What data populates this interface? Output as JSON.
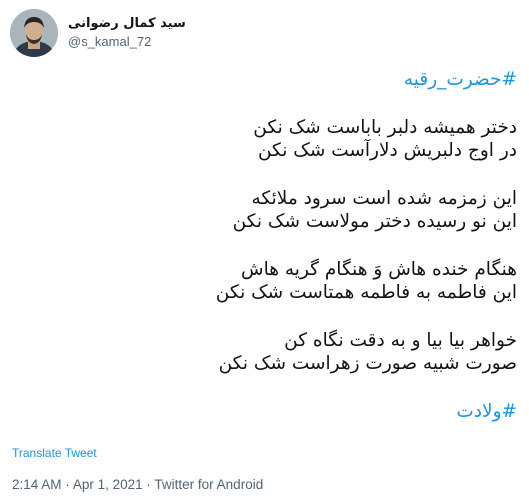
{
  "user": {
    "display_name": "سید کمال رضوانی",
    "handle": "@s_kamal_72"
  },
  "tweet": {
    "hashtag_top": "#حضرت_رقیه",
    "stanzas": [
      [
        "دختر همیشه دلبر باباست شک نکن",
        "در اوج دلبریش دلارآست شک نکن"
      ],
      [
        "این زمزمه شده است سرود ملائکه",
        "این نو رسیده دختر مولاست شک نکن"
      ],
      [
        "هنگام خنده هاش وَ هنگام گریه هاش",
        "این فاطمه به فاطمه همتاست شک نکن"
      ],
      [
        "خواهر بیا بیا و به دقت نگاه کن",
        "صورت شبیه صورت زهراست شک نکن"
      ]
    ],
    "hashtag_bottom": "#ولادت",
    "translate_label": "Translate Tweet",
    "time": "2:14 AM",
    "date": "Apr 1, 2021",
    "source": "Twitter for Android",
    "separator": "·"
  },
  "colors": {
    "link": "#1b95e0",
    "text": "#0f1419",
    "muted": "#536471"
  },
  "icons": {
    "avatar": "profile-photo-avatar"
  }
}
